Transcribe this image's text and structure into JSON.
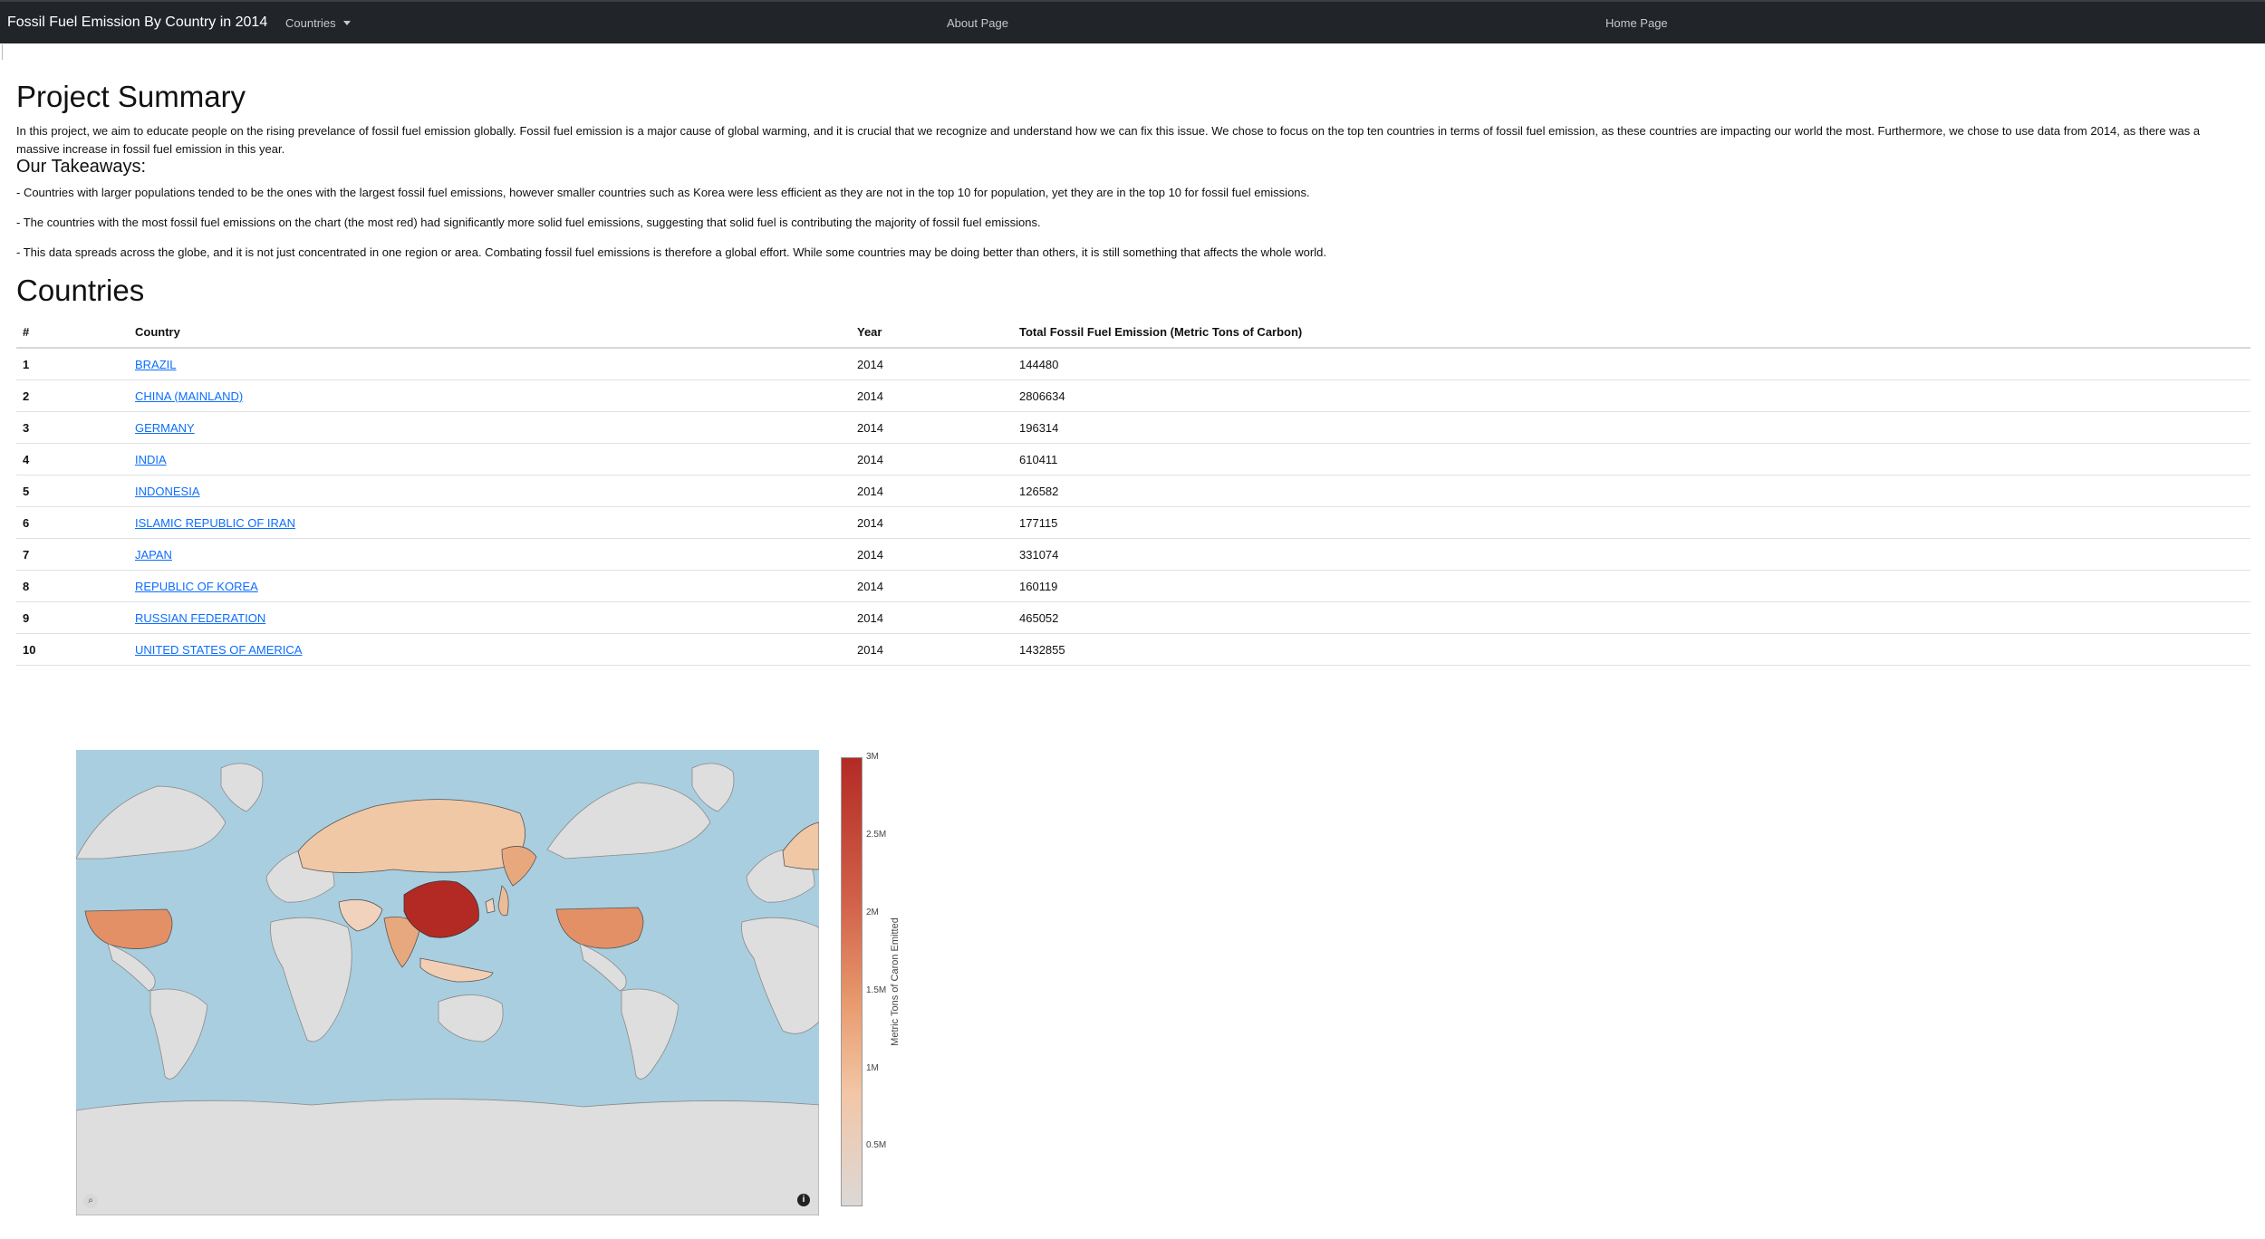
{
  "navbar": {
    "brand": "Fossil Fuel Emission By Country in 2014",
    "countries_menu": "Countries",
    "about_link": "About Page",
    "home_link": "Home Page"
  },
  "summary": {
    "title": "Project Summary",
    "intro": "In this project, we aim to educate people on the rising prevelance of fossil fuel emission globally. Fossil fuel emission is a major cause of global warming, and it is crucial that we recognize and understand how we can fix this issue. We chose to focus on the top ten countries in terms of fossil fuel emission, as these countries are impacting our world the most. Furthermore, we chose to use data from 2014, as there was a massive increase in fossil fuel emission in this year.",
    "takeaways_title": "Our Takeaways:",
    "takeaways": [
      "- Countries with larger populations tended to be the ones with the largest fossil fuel emissions, however smaller countries such as Korea were less efficient as they are not in the top 10 for population, yet they are in the top 10 for fossil fuel emissions.",
      "- The countries with the most fossil fuel emissions on the chart (the most red) had significantly more solid fuel emissions, suggesting that solid fuel is contributing the majority of fossil fuel emissions.",
      "- This data spreads across the globe, and it is not just concentrated in one region or area. Combating fossil fuel emissions is therefore a global effort. While some countries may be doing better than others, it is still something that affects the whole world."
    ]
  },
  "countries": {
    "title": "Countries",
    "headers": [
      "#",
      "Country",
      "Year",
      "Total Fossil Fuel Emission (Metric Tons of Carbon)"
    ],
    "rows": [
      {
        "num": "1",
        "country": "BRAZIL",
        "year": "2014",
        "total": "144480"
      },
      {
        "num": "2",
        "country": "CHINA (MAINLAND)",
        "year": "2014",
        "total": "2806634"
      },
      {
        "num": "3",
        "country": "GERMANY",
        "year": "2014",
        "total": "196314"
      },
      {
        "num": "4",
        "country": "INDIA",
        "year": "2014",
        "total": "610411"
      },
      {
        "num": "5",
        "country": "INDONESIA",
        "year": "2014",
        "total": "126582"
      },
      {
        "num": "6",
        "country": "ISLAMIC REPUBLIC OF IRAN",
        "year": "2014",
        "total": "177115"
      },
      {
        "num": "7",
        "country": "JAPAN",
        "year": "2014",
        "total": "331074"
      },
      {
        "num": "8",
        "country": "REPUBLIC OF KOREA",
        "year": "2014",
        "total": "160119"
      },
      {
        "num": "9",
        "country": "RUSSIAN FEDERATION",
        "year": "2014",
        "total": "465052"
      },
      {
        "num": "10",
        "country": "UNITED STATES OF AMERICA",
        "year": "2014",
        "total": "1432855"
      }
    ]
  },
  "map": {
    "colorbar_title": "Metric Tons of Caron Emitted",
    "colorbar_ticks": [
      "3M",
      "2.5M",
      "2M",
      "1.5M",
      "1M",
      "0.5M"
    ],
    "colors": {
      "ocean": "#a9cedf",
      "land": "#dedede",
      "low": "#dcd8d6",
      "mid": "#e89b6e",
      "high": "#b32a25"
    }
  }
}
